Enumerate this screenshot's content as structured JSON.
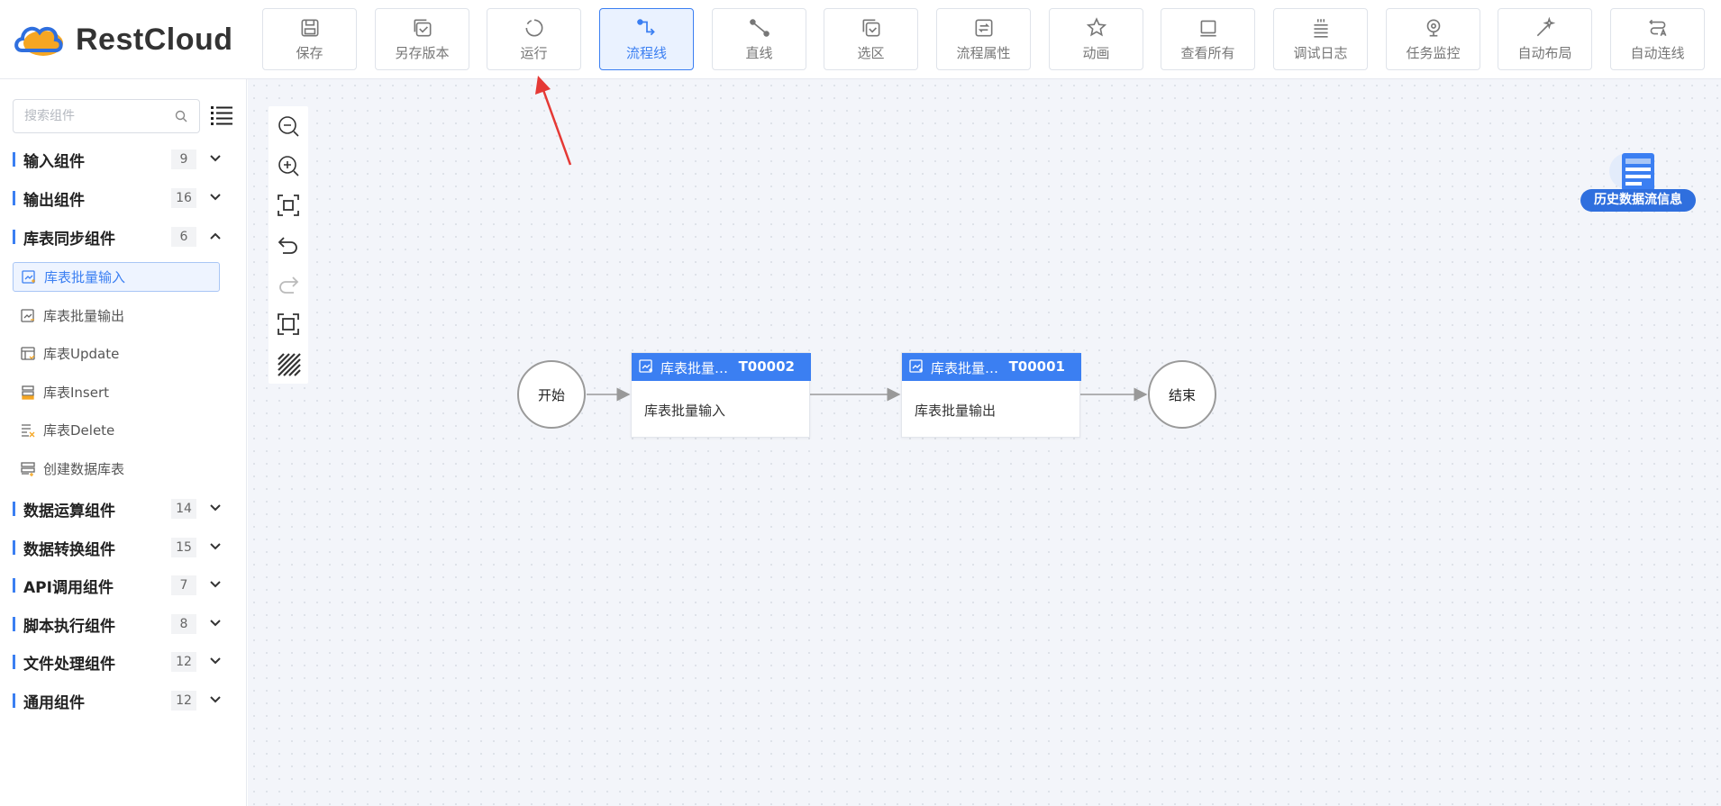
{
  "app": {
    "brand": "RestCloud",
    "accent": "#3b7ff2"
  },
  "toolbar": [
    {
      "label": "保存",
      "icon": "save-icon"
    },
    {
      "label": "另存版本",
      "icon": "save-version-icon"
    },
    {
      "label": "运行",
      "icon": "run-icon"
    },
    {
      "label": "流程线",
      "icon": "flowline-icon",
      "active": true
    },
    {
      "label": "直线",
      "icon": "straight-line-icon"
    },
    {
      "label": "选区",
      "icon": "select-area-icon"
    },
    {
      "label": "流程属性",
      "icon": "flow-properties-icon"
    },
    {
      "label": "动画",
      "icon": "animation-icon"
    },
    {
      "label": "查看所有",
      "icon": "view-all-icon"
    },
    {
      "label": "调试日志",
      "icon": "debug-log-icon"
    },
    {
      "label": "任务监控",
      "icon": "task-monitor-icon"
    },
    {
      "label": "自动布局",
      "icon": "auto-layout-icon"
    },
    {
      "label": "自动连线",
      "icon": "auto-connect-icon"
    }
  ],
  "sidebar": {
    "search_placeholder": "搜索组件",
    "groups": [
      {
        "label": "输入组件",
        "count": "9",
        "expanded": false
      },
      {
        "label": "输出组件",
        "count": "16",
        "expanded": false
      },
      {
        "label": "库表同步组件",
        "count": "6",
        "expanded": true
      },
      {
        "label": "数据运算组件",
        "count": "14",
        "expanded": false
      },
      {
        "label": "数据转换组件",
        "count": "15",
        "expanded": false
      },
      {
        "label": "API调用组件",
        "count": "7",
        "expanded": false
      },
      {
        "label": "脚本执行组件",
        "count": "8",
        "expanded": false
      },
      {
        "label": "文件处理组件",
        "count": "12",
        "expanded": false
      },
      {
        "label": "通用组件",
        "count": "12",
        "expanded": false
      }
    ],
    "sync_items": [
      {
        "label": "库表批量输入",
        "icon": "batch-input-icon",
        "active": true
      },
      {
        "label": "库表批量输出",
        "icon": "batch-output-icon"
      },
      {
        "label": "库表Update",
        "icon": "table-update-icon"
      },
      {
        "label": "库表Insert",
        "icon": "table-insert-icon"
      },
      {
        "label": "库表Delete",
        "icon": "table-delete-icon"
      },
      {
        "label": "创建数据库表",
        "icon": "create-table-icon"
      }
    ]
  },
  "canvas": {
    "history_label": "历史数据流信息",
    "start_label": "开始",
    "end_label": "结束",
    "nodes": [
      {
        "title": "库表批量…",
        "code": "T00002",
        "body": "库表批量输入"
      },
      {
        "title": "库表批量…",
        "code": "T00001",
        "body": "库表批量输出"
      }
    ]
  }
}
